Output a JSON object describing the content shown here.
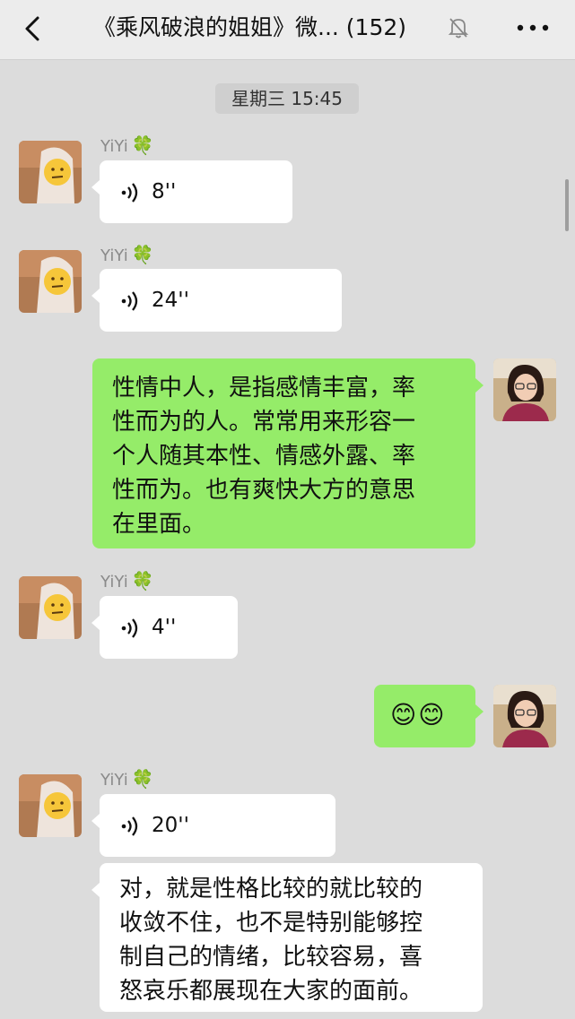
{
  "header": {
    "title": "《乘风破浪的姐姐》微... (152)",
    "back_icon": "chevron-left-icon",
    "mute_icon": "bell-muted-icon",
    "more_icon": "more-dots-icon"
  },
  "timestamp": "星期三 15:45",
  "messages": [
    {
      "sender": "YiYi",
      "sender_badge": "🍀",
      "type": "voice",
      "duration": "8''"
    },
    {
      "sender": "YiYi",
      "sender_badge": "🍀",
      "type": "voice",
      "duration": "24''"
    },
    {
      "sender": "me",
      "type": "text",
      "text": "性情中人，是指感情丰富，率\n性而为的人。常常用来形容一\n个人随其本性、情感外露、率\n性而为。也有爽快大方的意思\n在里面。"
    },
    {
      "sender": "YiYi",
      "sender_badge": "🍀",
      "type": "voice",
      "duration": "4''"
    },
    {
      "sender": "me",
      "type": "emoji",
      "text": "😊😊"
    },
    {
      "sender": "YiYi",
      "sender_badge": "🍀",
      "type": "voice",
      "duration": "20''"
    },
    {
      "sender": "YiYi",
      "type": "text",
      "text": "对，就是性格比较的就比较的\n收敛不住，也不是特别能够控\n制自己的情绪，比较容易，喜\n怒哀乐都展现在大家的面前。"
    }
  ],
  "colors": {
    "chat_background": "#dcdcdc",
    "sent_bubble": "#95ec69",
    "received_bubble": "#ffffff",
    "header_background": "#ececec"
  }
}
